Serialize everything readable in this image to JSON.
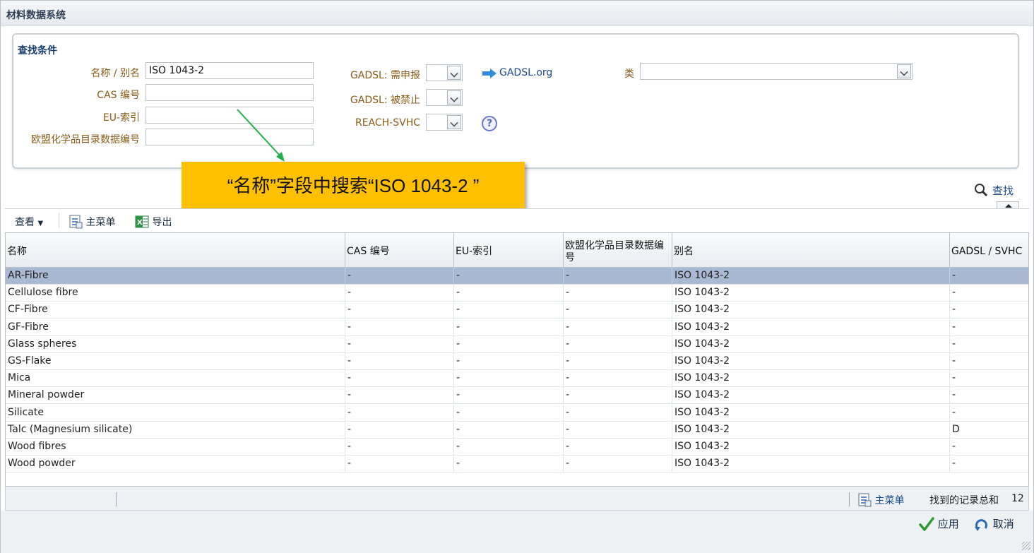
{
  "window": {
    "title": "材料数据系统"
  },
  "search": {
    "panel_title": "查找条件",
    "name_label": "名称 / 别名",
    "name_value": "ISO 1043-2",
    "cas_label": "CAS 编号",
    "cas_value": "",
    "eu_label": "EU-索引",
    "eu_value": "",
    "ec_label": "欧盟化学品目录数据编号",
    "ec_value": "",
    "gadsl_declare_label": "GADSL: 需申报",
    "gadsl_prohibited_label": "GADSL: 被禁止",
    "reach_label": "REACH-SVHC",
    "gadsl_link": "GADSL.org",
    "class_label": "类",
    "search_button": "查找"
  },
  "callout": {
    "text": "“名称”字段中搜索“ISO 1043-2 ”"
  },
  "toolbar": {
    "view": "查看",
    "main_menu": "主菜单",
    "export": "导出"
  },
  "table": {
    "columns": [
      "名称",
      "CAS 编号",
      "EU-索引",
      "欧盟化学品目录数据编号",
      "别名",
      "GADSL / SVHC"
    ],
    "rows": [
      [
        "AR-Fibre",
        "-",
        "-",
        "-",
        "ISO 1043-2",
        "-"
      ],
      [
        "Cellulose fibre",
        "-",
        "-",
        "-",
        "ISO 1043-2",
        "-"
      ],
      [
        "CF-Fibre",
        "-",
        "-",
        "-",
        "ISO 1043-2",
        "-"
      ],
      [
        "GF-Fibre",
        "-",
        "-",
        "-",
        "ISO 1043-2",
        "-"
      ],
      [
        "Glass spheres",
        "-",
        "-",
        "-",
        "ISO 1043-2",
        "-"
      ],
      [
        "GS-Flake",
        "-",
        "-",
        "-",
        "ISO 1043-2",
        "-"
      ],
      [
        "Mica",
        "-",
        "-",
        "-",
        "ISO 1043-2",
        "-"
      ],
      [
        "Mineral powder",
        "-",
        "-",
        "-",
        "ISO 1043-2",
        "-"
      ],
      [
        "Silicate",
        "-",
        "-",
        "-",
        "ISO 1043-2",
        "-"
      ],
      [
        "Talc (Magnesium silicate)",
        "-",
        "-",
        "-",
        "ISO 1043-2",
        "D"
      ],
      [
        "Wood fibres",
        "-",
        "-",
        "-",
        "ISO 1043-2",
        "-"
      ],
      [
        "Wood powder",
        "-",
        "-",
        "-",
        "ISO 1043-2",
        "-"
      ]
    ],
    "selected_row": 0
  },
  "status": {
    "main_menu": "主菜单",
    "total_label": "找到的记录总和",
    "total": "12"
  },
  "actions": {
    "apply": "应用",
    "cancel": "取消"
  },
  "colors": {
    "callout": "#ffc000",
    "selected_row": "#a9b9d3",
    "arrow": "#22b04a"
  }
}
